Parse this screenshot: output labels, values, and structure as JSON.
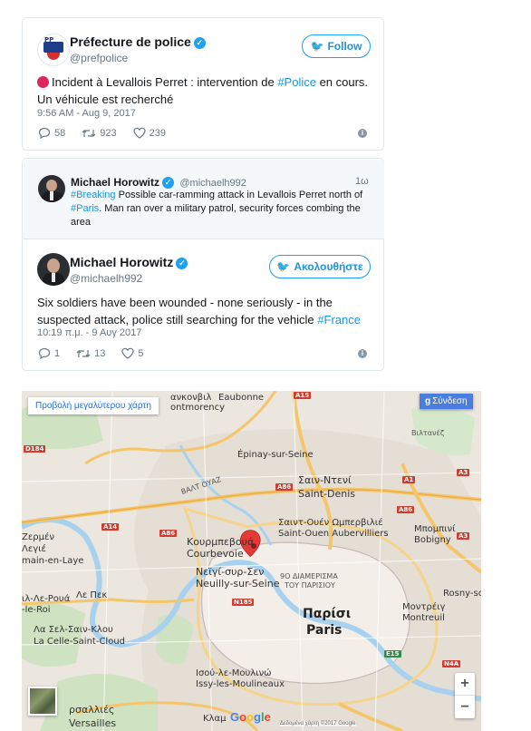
{
  "tweet1": {
    "name": "Préfecture de police",
    "handle": "@prefpolice",
    "follow_label": "Follow",
    "text_before": "Incident à Levallois Perret : intervention de ",
    "hashtag": "#Police",
    "text_after": " en cours.",
    "text_line2": "Un véhicule est recherché",
    "timestamp": "9:56 AM - Aug 9, 2017",
    "replies": "58",
    "retweets": "923",
    "likes": "239"
  },
  "tweet2": {
    "quoted": {
      "name": "Michael Horowitz",
      "handle": "@michaelh992",
      "age": "1ω",
      "hashtag1": "#Breaking",
      "text1": " Possible car-ramming attack in Levallois Perret north of",
      "hashtag2": "#Paris",
      "text2": ". Man ran over a military patrol, security forces combing the",
      "text3": "area"
    },
    "name": "Michael Horowitz",
    "handle": "@michaelh992",
    "follow_label": "Ακολουθήστε",
    "line1": "Six soldiers have been wounded - none seriously - in the",
    "line2_before": "suspected attack, police still searching for the vehicle ",
    "hashtag": "#France",
    "timestamp": "10:19 π.μ. - 9 Αυγ 2017",
    "replies": "1",
    "retweets": "13",
    "likes": "5"
  },
  "map": {
    "view_larger": "Προβολή μεγαλύτερου χάρτη",
    "signin": "Σύνδεση",
    "zoom_in": "+",
    "zoom_out": "−",
    "google": "Google",
    "terms": "Δεδομένα χάρτη ©2017 Google",
    "labels": {
      "eaubonne": "Eaubonne",
      "enghien": "ανκονβιλ",
      "montmorency": "ontmorency",
      "epinay": "Épinay-sur-Seine",
      "saintdenis_gr": "Σαιν-Ντενί",
      "saintdenis": "Saint-Denis",
      "villetaneuse": "Βιλτανέζ",
      "saintouen_gr": "Σαιντ-Ουέν Ωμπερβιλιέ",
      "saintouen": "Saint-Ouen Aubervilliers",
      "bobigny_gr": "Μπομπινί",
      "bobigny": "Bobigny",
      "courbevoie_gr": "Κουρμπεβουά",
      "courbevoie": "Courbevoie",
      "neuilly_gr": "Νεϊγί-συρ-Σεν",
      "neuilly": "Neuilly-sur-Seine",
      "arrond_gr": "9Ο ΔΙΑΜΕΡΙΣΜΑ",
      "arrond_gr2": "ΤΟΥ ΠΑΡΙΣΙΟΥ",
      "paris_gr": "Παρίσι",
      "paris": "Paris",
      "germain_gr": "Ζερμέν",
      "germain_gr2": "Λεγιέ",
      "germain": "main-en-Laye",
      "celle_gr": "Λα Σελ-Σαιν-Κλου",
      "celle": "La Celle-Saint-Cloud",
      "lepecq": "Λε Πεκ",
      "chatou": "ιλ-Λε-Ρουά",
      "roirot": "-le-Roi",
      "montreuil_gr": "Μοντρέιγ",
      "montreuil": "Montreuil",
      "rosny": "Rosny-so",
      "issy_gr": "Ισού-λε-Μουλινώ",
      "issy": "Issy-les-Moulineaux",
      "versailles_gr": "ρσαλλιές",
      "versailles": "Versailles",
      "clamart": "Κλαμ",
      "jonction": "ΒΑΛΤ ΟΥΑΖ",
      "a86": "A86",
      "a15": "A15",
      "a1": "A1",
      "a3": "A3",
      "a14": "A14",
      "n185": "N185",
      "e15": "E15",
      "a4": "N4A",
      "d184": "D184"
    }
  }
}
